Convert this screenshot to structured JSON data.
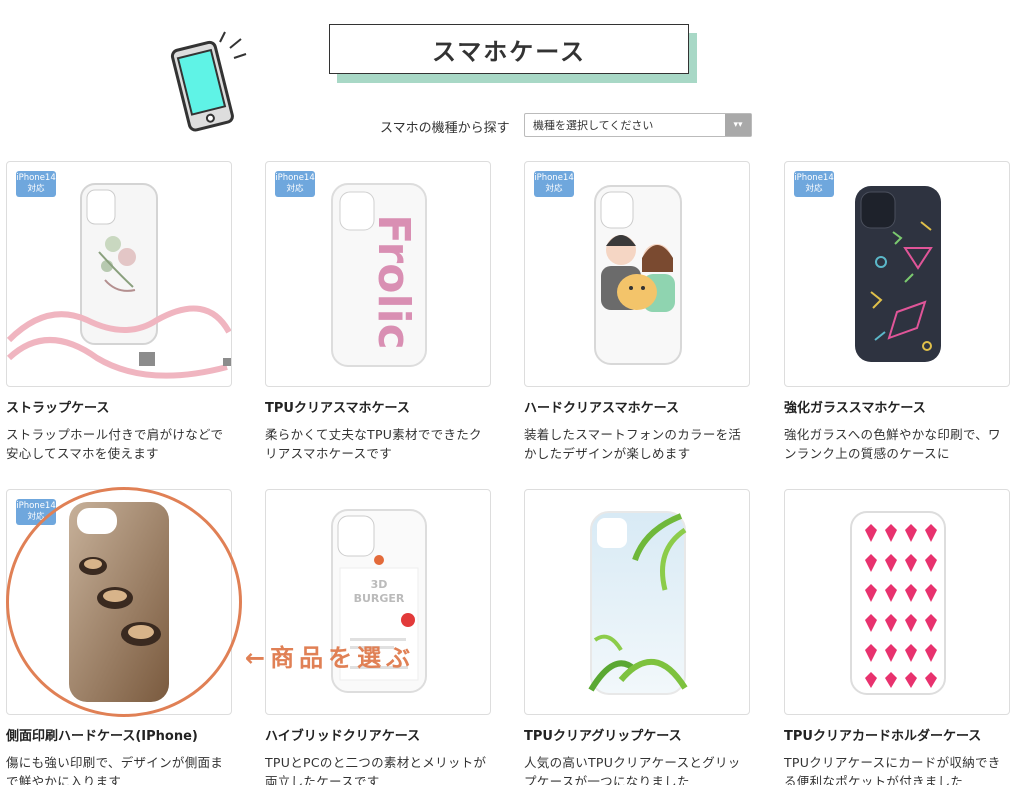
{
  "page": {
    "title": "スマホケース",
    "filter": {
      "label": "スマホの機種から探す",
      "placeholder": "機種を選択してください"
    },
    "callout": "←商品を選ぶ"
  },
  "colors": {
    "title_shadow": "#a8d8c6",
    "badge": "#6fa7dd",
    "callout": "#e08055"
  },
  "products": [
    {
      "badge": "iPhone14\n対応",
      "title": "ストラップケース",
      "desc": "ストラップホール付きで肩がけなどで安心してスマホを使えます",
      "image": "strap-case-flower"
    },
    {
      "badge": "iPhone14\n対応",
      "title": "TPUクリアスマホケース",
      "desc": "柔らかくて丈夫なTPU素材でできたクリアスマホケースです",
      "image": "tpu-clear-frolic"
    },
    {
      "badge": "iPhone14\n対応",
      "title": "ハードクリアスマホケース",
      "desc": "装着したスマートフォンのカラーを活かしたデザインが楽しめます",
      "image": "hard-clear-couple-dog"
    },
    {
      "badge": "iPhone14\n対応",
      "title": "強化ガラススマホケース",
      "desc": "強化ガラスへの色鮮やかな印刷で、ワンランク上の質感のケースに",
      "image": "glass-geometric"
    },
    {
      "badge": "iPhone14\n対応",
      "title": "側面印刷ハードケース(IPhone)",
      "desc": "傷にも強い印刷で、デザインが側面まで鮮やかに入ります",
      "image": "side-print-coffee"
    },
    {
      "badge": "",
      "title": "ハイブリッドクリアケース",
      "desc": "TPUとPCのと二つの素材とメリットが両立したケースです",
      "image": "hybrid-burger"
    },
    {
      "badge": "",
      "title": "TPUクリアグリップケース",
      "desc": "人気の高いTPUクリアケースとグリップケースが一つになりました",
      "image": "grip-palm"
    },
    {
      "badge": "",
      "title": "TPUクリアカードホルダーケース",
      "desc": "TPUクリアケースにカードが収納できる便利なポケットが付きました",
      "image": "cardholder-hearts"
    }
  ]
}
